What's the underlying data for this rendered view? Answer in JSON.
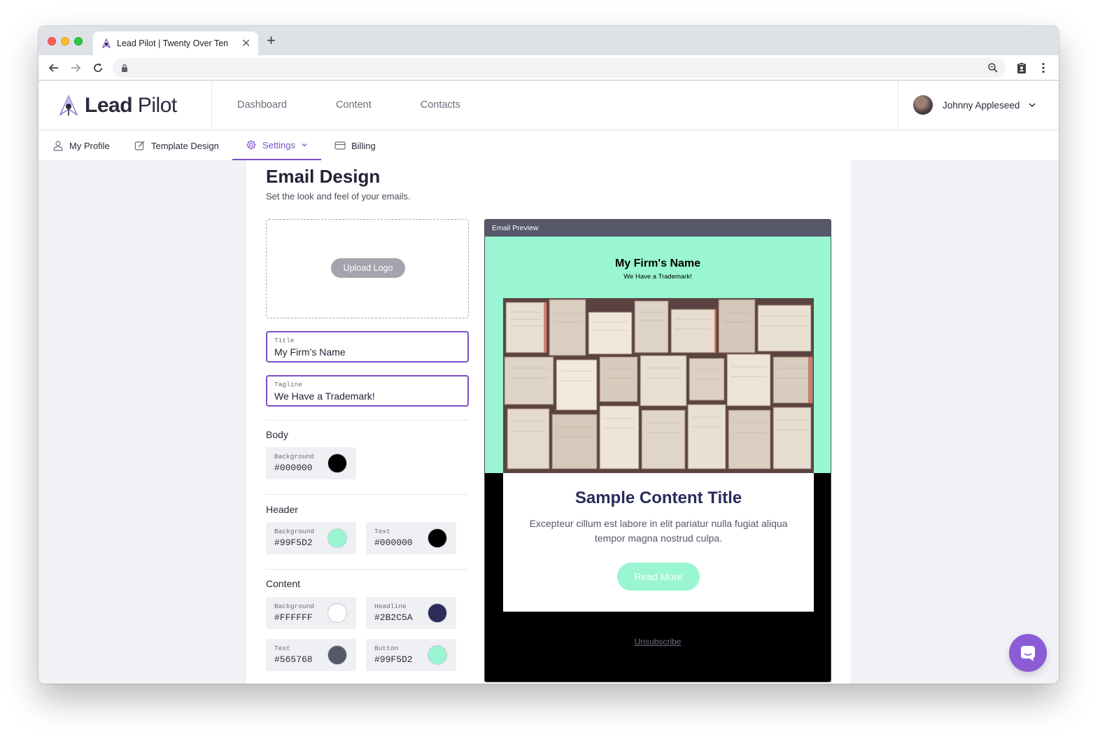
{
  "browser": {
    "tab_title": "Lead Pilot | Twenty Over Ten",
    "close_glyph": "✕",
    "new_tab_glyph": "+"
  },
  "header": {
    "logo_bold": "Lead",
    "logo_light": " Pilot",
    "nav": [
      "Dashboard",
      "Content",
      "Contacts"
    ],
    "user_name": "Johnny Appleseed"
  },
  "subnav": {
    "items": [
      "My Profile",
      "Template Design",
      "Settings",
      "Billing"
    ],
    "active": "Settings"
  },
  "page": {
    "title": "Email Design",
    "subtitle": "Set the look and feel of your emails."
  },
  "form": {
    "upload_label": "Upload Logo",
    "title_label": "Title",
    "title_value": "My Firm’s Name",
    "tagline_label": "Tagline",
    "tagline_value": "We Have a Trademark!",
    "sections": {
      "body": "Body",
      "header": "Header",
      "content": "Content"
    },
    "colors": {
      "body_background": {
        "label": "Background",
        "value": "#000000"
      },
      "header_background": {
        "label": "Background",
        "value": "#99F5D2"
      },
      "header_text": {
        "label": "Text",
        "value": "#000000"
      },
      "content_background": {
        "label": "Background",
        "value": "#FFFFFF"
      },
      "content_headline": {
        "label": "Headline",
        "value": "#2B2C5A"
      },
      "content_text": {
        "label": "Text",
        "value": "#565768"
      },
      "content_button": {
        "label": "Button",
        "value": "#99F5D2"
      }
    }
  },
  "preview": {
    "bar_label": "Email Preview",
    "firm_name": "My Firm's Name",
    "tagline": "We Have a Trademark!",
    "headline": "Sample Content Title",
    "text": "Excepteur cillum est labore in elit pariatur nulla fugiat aliqua tempor magna nostrud culpa.",
    "button": "Read More",
    "unsubscribe": "Unsubscribe"
  },
  "accent": "#7B4FC9"
}
